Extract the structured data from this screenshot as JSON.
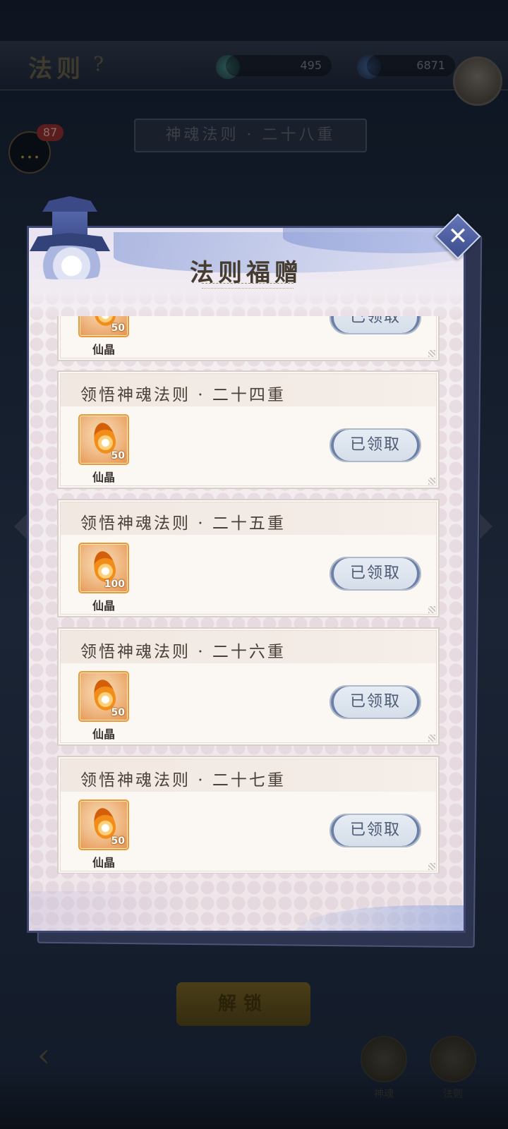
{
  "background": {
    "screen_title": "法则",
    "help_icon": "?",
    "resource_1": "495",
    "resource_2": "6871",
    "chat_badge": "87",
    "banner": "神魂法则 · 二十八重",
    "unlock_button": "解锁",
    "nav_1": "神魂",
    "nav_2": "法则"
  },
  "modal": {
    "title": "法则福赠",
    "close_icon": "✕",
    "items": [
      {
        "title": "",
        "reward_count": "50",
        "reward_name": "仙晶",
        "button": "已领取"
      },
      {
        "title": "领悟神魂法则 · 二十四重",
        "reward_count": "50",
        "reward_name": "仙晶",
        "button": "已领取"
      },
      {
        "title": "领悟神魂法则 · 二十五重",
        "reward_count": "100",
        "reward_name": "仙晶",
        "button": "已领取"
      },
      {
        "title": "领悟神魂法则 · 二十六重",
        "reward_count": "50",
        "reward_name": "仙晶",
        "button": "已领取"
      },
      {
        "title": "领悟神魂法则 · 二十七重",
        "reward_count": "50",
        "reward_name": "仙晶",
        "button": "已领取"
      }
    ]
  },
  "colors": {
    "frame": "#3c4670",
    "reward_border": "#e99a34",
    "button_text": "#4c5a74"
  }
}
